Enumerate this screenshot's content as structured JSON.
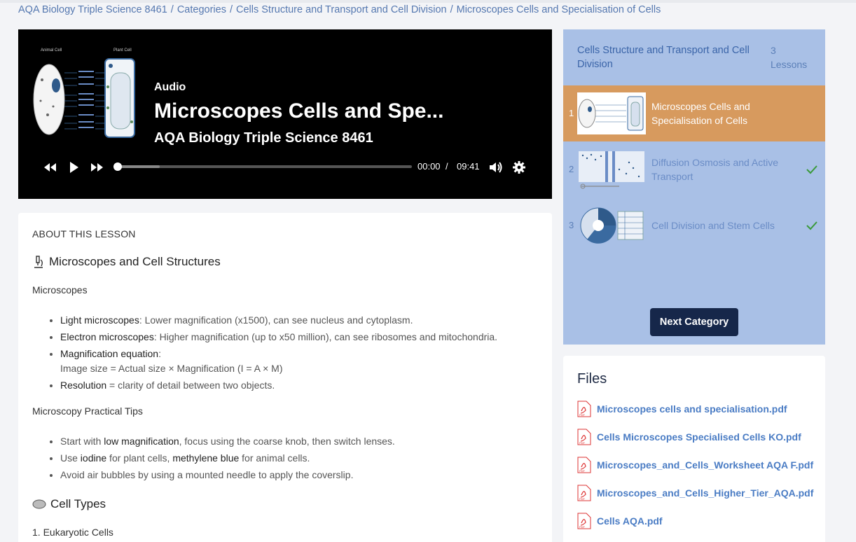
{
  "breadcrumb": {
    "items": [
      "AQA Biology Triple Science 8461",
      "Categories",
      "Cells Structure and Transport and Cell Division",
      "Microscopes Cells and Specialisation of Cells"
    ],
    "separator": "/"
  },
  "player": {
    "type_label": "Audio",
    "title": "Microscopes Cells and Spe...",
    "subtitle": "AQA Biology Triple Science 8461",
    "current_time": "00:00",
    "time_separator": "/",
    "duration": "09:41",
    "progress_fraction": 0.0,
    "thumbnail_labels": [
      "Animal Cell",
      "Plant Cell"
    ]
  },
  "about": {
    "heading": "ABOUT THIS LESSON",
    "section1_title": "Microscopes and Cell Structures",
    "microscopes_heading": "Microscopes",
    "microscopes_items": [
      {
        "bold": "Light microscopes",
        "text": ": Lower magnification (x1500), can see nucleus and cytoplasm."
      },
      {
        "bold": "Electron microscopes",
        "text": ": Higher magnification (up to x50 million), can see ribosomes and mitochondria."
      },
      {
        "bold": "Magnification equation",
        "text": ":",
        "sub": "Image size = Actual size × Magnification (I = A × M)"
      },
      {
        "bold": "Resolution",
        "text": " = clarity of detail between two objects."
      }
    ],
    "tips_heading": "Microscopy Practical Tips",
    "tips_items": [
      {
        "pre": "Start with ",
        "bold": "low magnification",
        "post": ", focus using the coarse knob, then switch lenses."
      },
      {
        "pre": "Use ",
        "bold": "iodine",
        "mid": " for plant cells, ",
        "bold2": "methylene blue",
        "post": " for animal cells."
      },
      {
        "pre": "Avoid air bubbles by using a mounted needle to apply the coverslip."
      }
    ],
    "section2_title": "Cell Types",
    "eukaryotic_heading": "1. Eukaryotic Cells"
  },
  "lessons": {
    "category_title": "Cells Structure and Transport and Cell Division",
    "count_label": "3 Lessons",
    "items": [
      {
        "num": "1",
        "title": "Microscopes Cells and Specialisation of Cells",
        "active": true,
        "completed": false
      },
      {
        "num": "2",
        "title": "Diffusion Osmosis and Active Transport",
        "active": false,
        "completed": true
      },
      {
        "num": "3",
        "title": "Cell Division and Stem Cells",
        "active": false,
        "completed": true
      }
    ],
    "next_button": "Next Category"
  },
  "files": {
    "heading": "Files",
    "items": [
      "Microscopes cells and specialisation.pdf",
      "Cells Microscopes Specialised Cells KO.pdf",
      "Microscopes_and_Cells_Worksheet AQA F.pdf",
      "Microscopes_and_Cells_Higher_Tier_AQA.pdf",
      "Cells AQA.pdf"
    ],
    "icon_label": "PDF"
  },
  "colors": {
    "accent_orange": "#d79a5e",
    "panel_blue": "#a9c0e6",
    "button_navy": "#16274a",
    "link_blue": "#4a7cc4",
    "check_green": "#3a9a3a"
  }
}
